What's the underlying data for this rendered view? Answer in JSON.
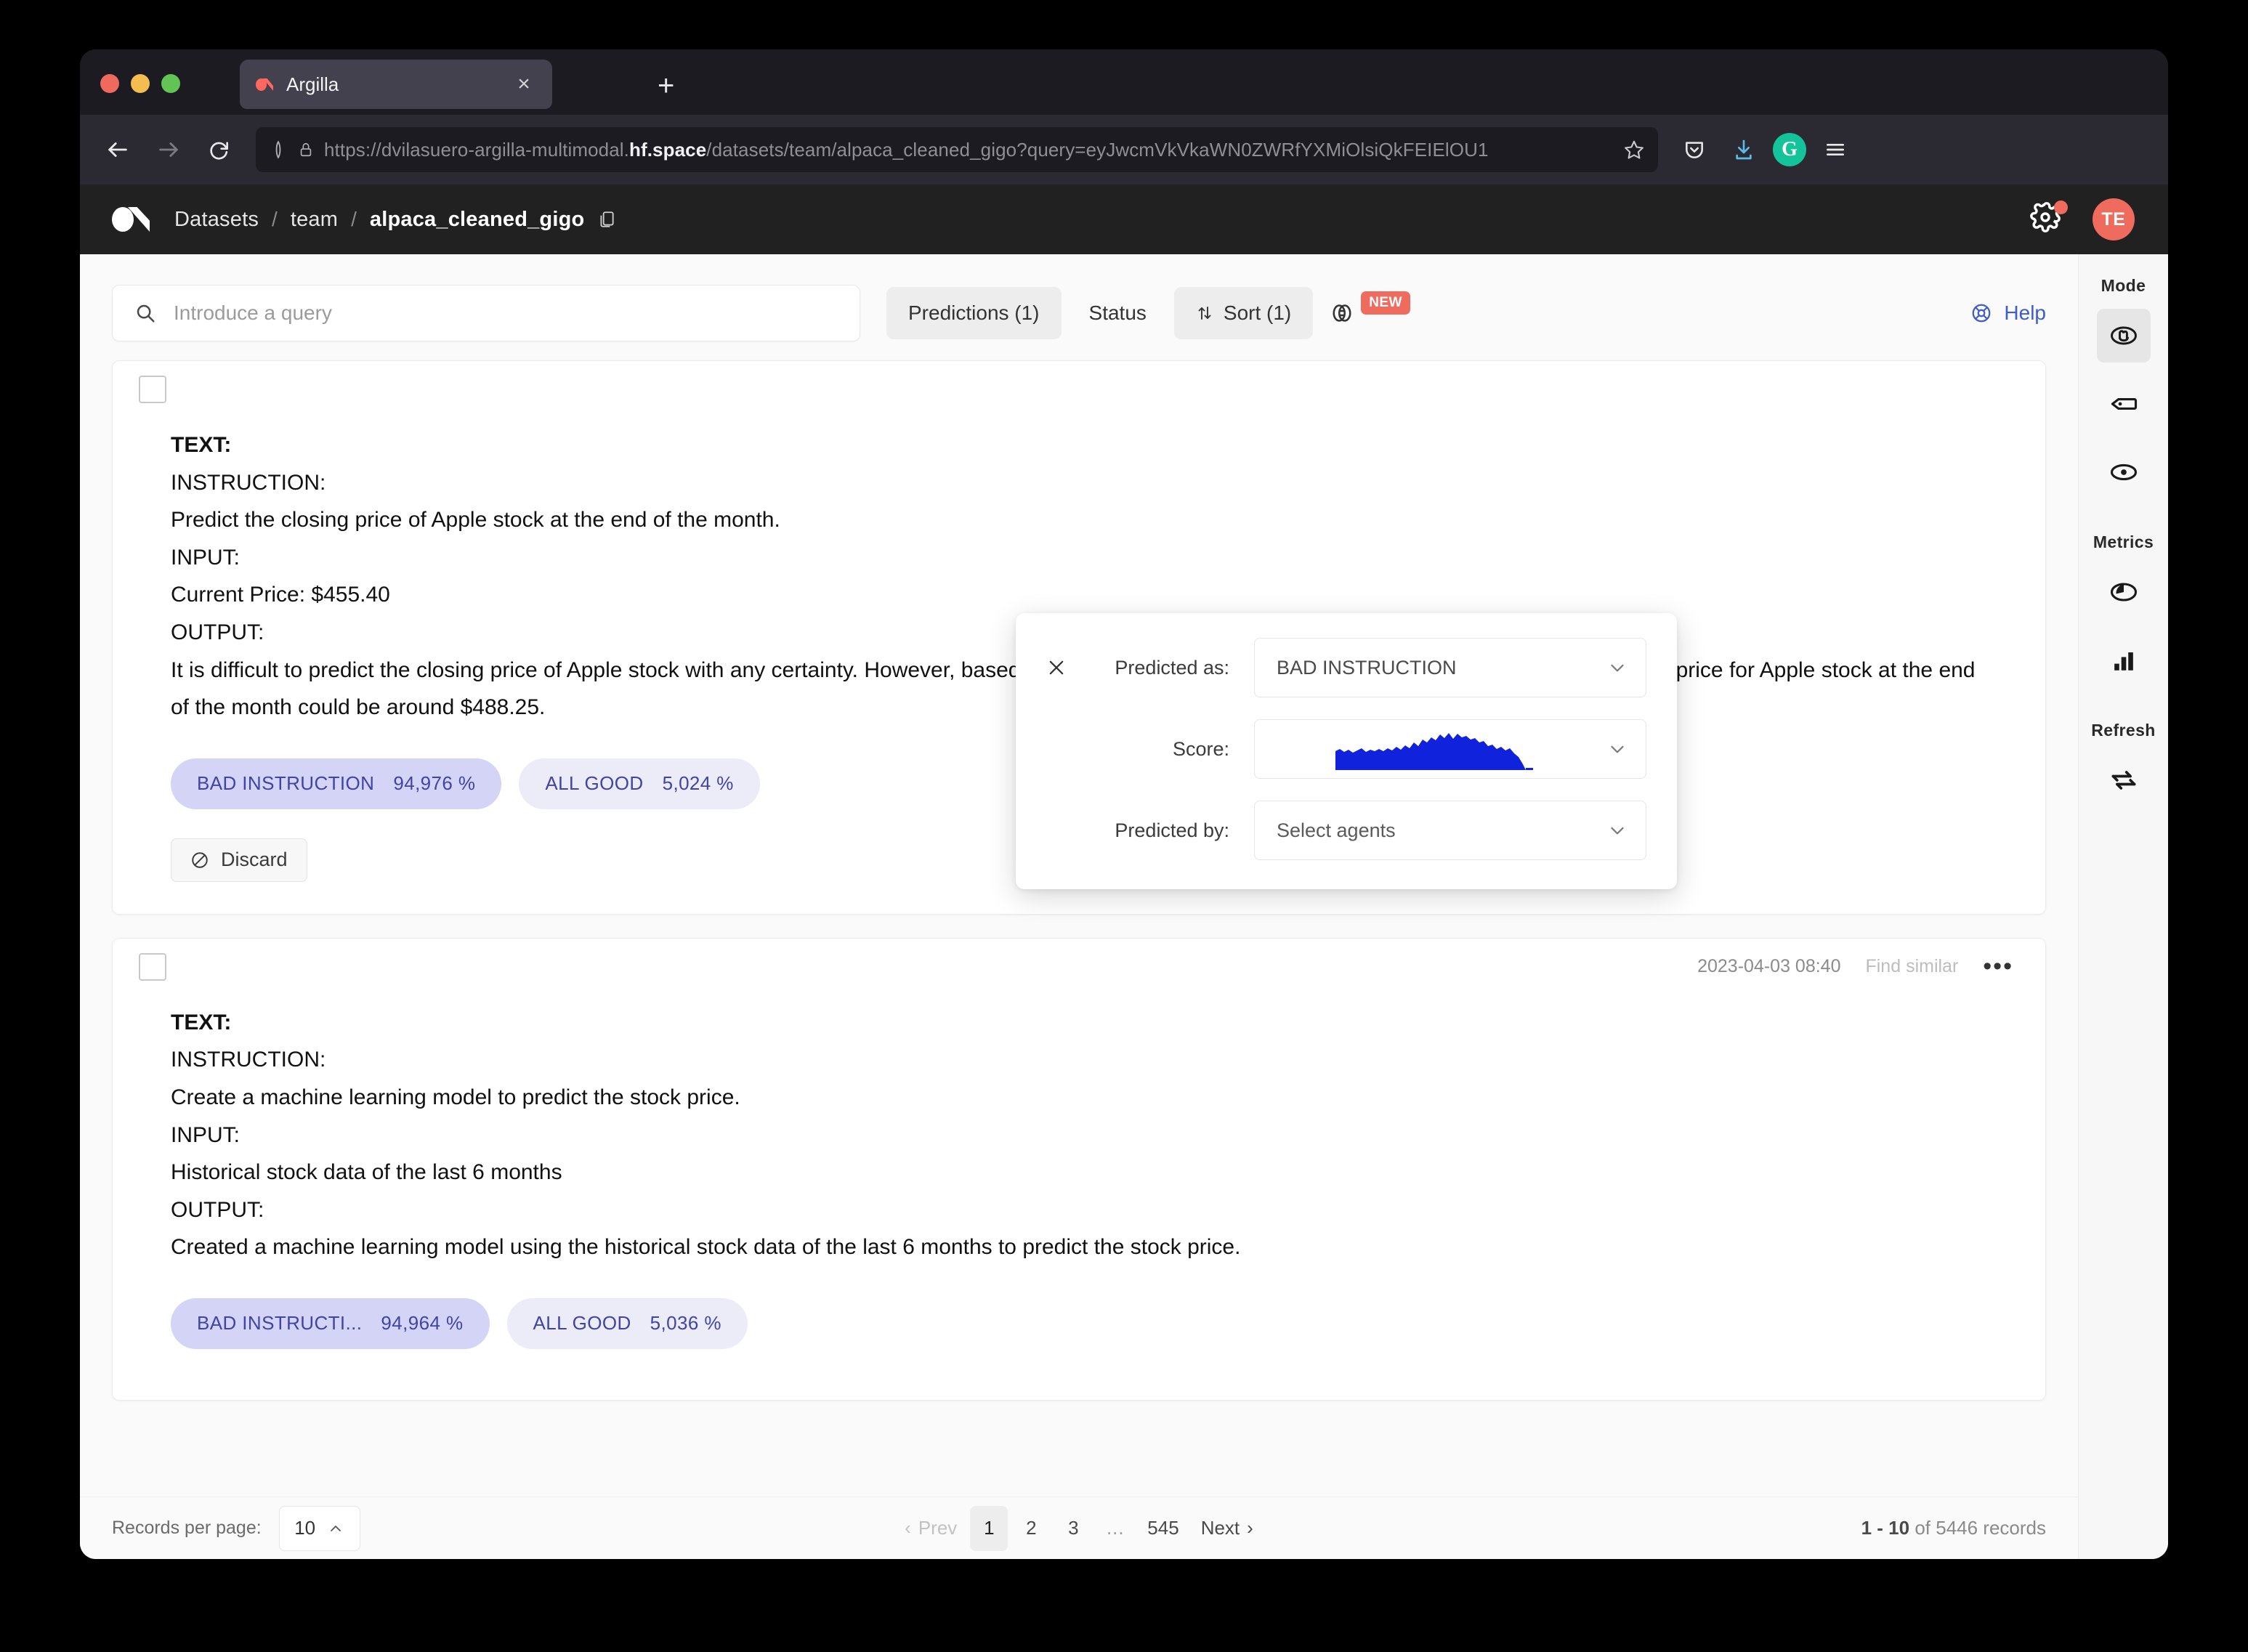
{
  "browser": {
    "tab": {
      "title": "Argilla",
      "favicon": "argilla-favicon",
      "close": "×"
    },
    "newtab_label": "+",
    "url": {
      "prefix": "https://dvilasuero-argilla-multimodal.",
      "host_bold": "hf.space",
      "suffix": "/datasets/team/alpaca_cleaned_gigo?query=eyJwcmVkVkaWN0ZWRfYXMiOlsiQkFEIElOU1"
    },
    "nav": {
      "back": "back-arrow",
      "forward": "forward-arrow",
      "reload": "reload-icon",
      "shield": "shield-icon",
      "lock": "lock-icon",
      "star": "bookmark-star-icon",
      "pocket": "pocket-icon",
      "downloads": "download-icon",
      "grammarly": "G",
      "menu": "hamburger-menu-icon"
    }
  },
  "app_header": {
    "logo": "argilla-logo",
    "breadcrumb": [
      {
        "label": "Datasets",
        "current": false
      },
      {
        "label": "team",
        "current": false
      },
      {
        "label": "alpaca_cleaned_gigo",
        "current": true
      }
    ],
    "separator": "/",
    "copy_icon": "copy-icon",
    "settings_icon": "gear-icon",
    "avatar_initials": "TE"
  },
  "toolbar": {
    "search_placeholder": "Introduce a query",
    "search_icon": "search-icon",
    "filters": [
      {
        "label": "Predictions (1)",
        "active": true
      },
      {
        "label": "Status",
        "active": false
      },
      {
        "label": "Sort (1)",
        "active": true,
        "icon": "sort-icon"
      }
    ],
    "similarity_icon": "similarity-icon",
    "new_badge": "NEW",
    "help_label": "Help",
    "help_icon": "lifebuoy-icon"
  },
  "predictions_panel": {
    "close_icon": "close-icon",
    "rows": [
      {
        "label": "Predicted as:",
        "value": "BAD INSTRUCTION",
        "type": "select"
      },
      {
        "label": "Score:",
        "value": "",
        "type": "histogram"
      },
      {
        "label": "Predicted by:",
        "value": "Select agents",
        "type": "select"
      }
    ],
    "caret_icon": "chevron-down-icon",
    "histogram_color": "#1122dd"
  },
  "records": [
    {
      "date": "",
      "find_similar": "",
      "lines": [
        {
          "text": "TEXT:",
          "bold": true
        },
        {
          "text": "INSTRUCTION:",
          "bold": false
        },
        {
          "text": "Predict the closing price of Apple stock at the end of the month.",
          "bold": false
        },
        {
          "text": "INPUT:",
          "bold": false
        },
        {
          "text": "Current Price: $455.40",
          "bold": false
        },
        {
          "text": "OUTPUT:",
          "bold": false
        },
        {
          "text": "It is difficult to predict the closing price of Apple stock with any certainty. However, based on historical performance and market trends, the estimated closing price for Apple stock at the end of the month could be around $488.25.",
          "bold": false
        }
      ],
      "pills": [
        {
          "label": "BAD INSTRUCTION",
          "score": "94,976 %",
          "primary": true
        },
        {
          "label": "ALL GOOD",
          "score": "5,024 %",
          "primary": false
        }
      ],
      "discard_label": "Discard",
      "discard_icon": "discard-icon",
      "show_discard": true,
      "show_meta": false
    },
    {
      "date": "2023-04-03 08:40",
      "find_similar": "Find similar",
      "lines": [
        {
          "text": "TEXT:",
          "bold": true
        },
        {
          "text": "INSTRUCTION:",
          "bold": false
        },
        {
          "text": "Create a machine learning model to predict the stock price.",
          "bold": false
        },
        {
          "text": "INPUT:",
          "bold": false
        },
        {
          "text": "Historical stock data of the last 6 months",
          "bold": false
        },
        {
          "text": "OUTPUT:",
          "bold": false
        },
        {
          "text": "Created a machine learning model using the historical stock data of the last 6 months to predict the stock price.",
          "bold": false
        }
      ],
      "pills": [
        {
          "label": "BAD INSTRUCTI...",
          "score": "94,964 %",
          "primary": true
        },
        {
          "label": "ALL GOOD",
          "score": "5,036 %",
          "primary": false
        }
      ],
      "discard_label": "Discard",
      "discard_icon": "discard-icon",
      "show_discard": false,
      "show_meta": true,
      "more_icon": "more-options-icon"
    }
  ],
  "pagination": {
    "records_per_page_label": "Records per page:",
    "records_per_page_value": "10",
    "prev_label": "Prev",
    "next_label": "Next",
    "pages": [
      "1",
      "2",
      "3",
      "...",
      "545"
    ],
    "current_page": "1",
    "count_range": "1 - 10",
    "count_suffix": "of 5446 records"
  },
  "sidebar": {
    "sections": [
      {
        "title": "Mode",
        "items": [
          {
            "icon": "annotate-hand-icon",
            "active": true
          },
          {
            "icon": "tag-label-icon",
            "active": false
          },
          {
            "icon": "eye-explore-icon",
            "active": false
          }
        ]
      },
      {
        "title": "Metrics",
        "items": [
          {
            "icon": "pie-chart-icon",
            "active": false
          },
          {
            "icon": "bar-chart-icon",
            "active": false
          }
        ]
      },
      {
        "title": "Refresh",
        "items": [
          {
            "icon": "refresh-icon",
            "active": false
          }
        ]
      }
    ]
  }
}
